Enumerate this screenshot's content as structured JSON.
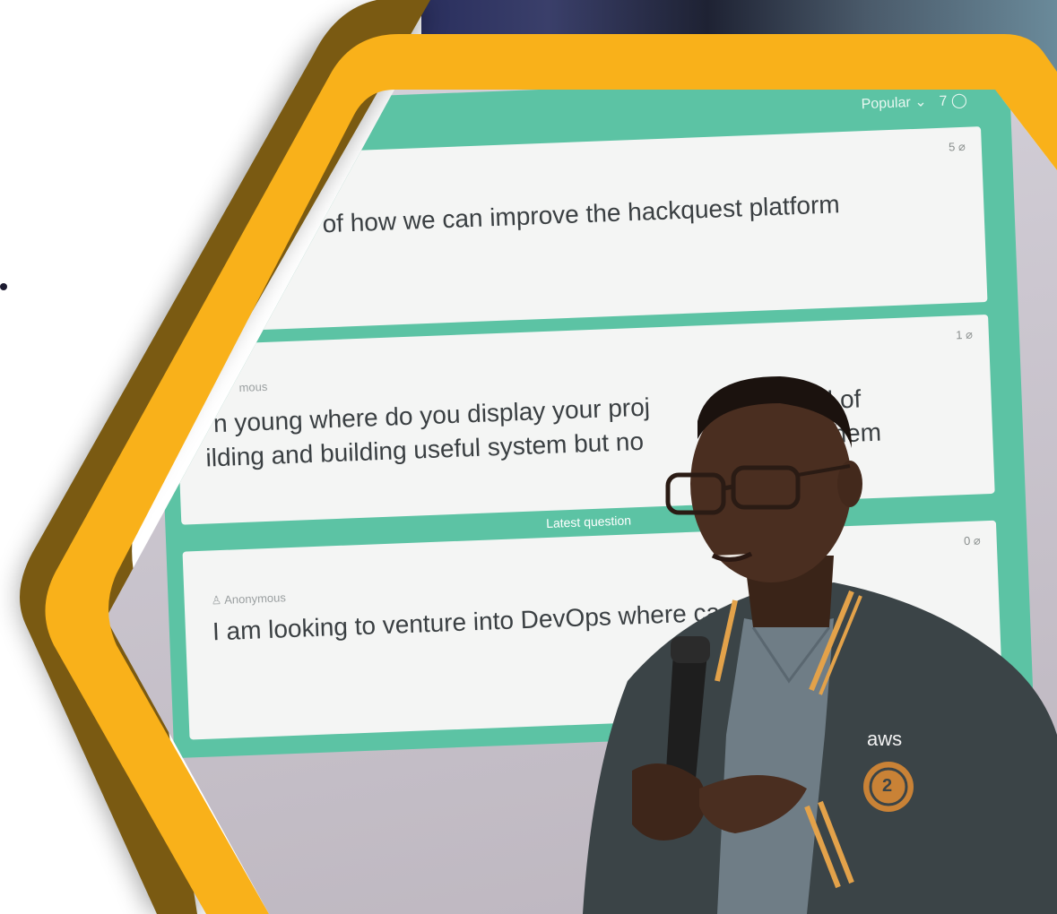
{
  "screen": {
    "sort_label": "Popular",
    "sort_chevron": "⌄",
    "question_count": "7",
    "latest_label": "Latest question"
  },
  "questions": [
    {
      "votes": "5",
      "author": "",
      "text": "of how we can improve the hackquest platform"
    },
    {
      "votes": "1",
      "author": "mous",
      "line1": "n young where do you display your proj",
      "line1b": "tead of",
      "line2": "ilding and building useful system but no",
      "line2b": "ake them"
    },
    {
      "votes": "0",
      "author": "Anonymous",
      "text": "I am looking to venture into DevOps where ca"
    }
  ],
  "jacket": {
    "brand": "aws",
    "badge": "2"
  },
  "colors": {
    "frame_yellow": "#F9B11A",
    "frame_shadow": "#7A5A12",
    "screen_green": "#5CC3A4",
    "navy": "#2E2F6B"
  },
  "icons": {
    "vote": "thumb-up-icon",
    "comments": "comment-icon",
    "author": "person-icon"
  }
}
